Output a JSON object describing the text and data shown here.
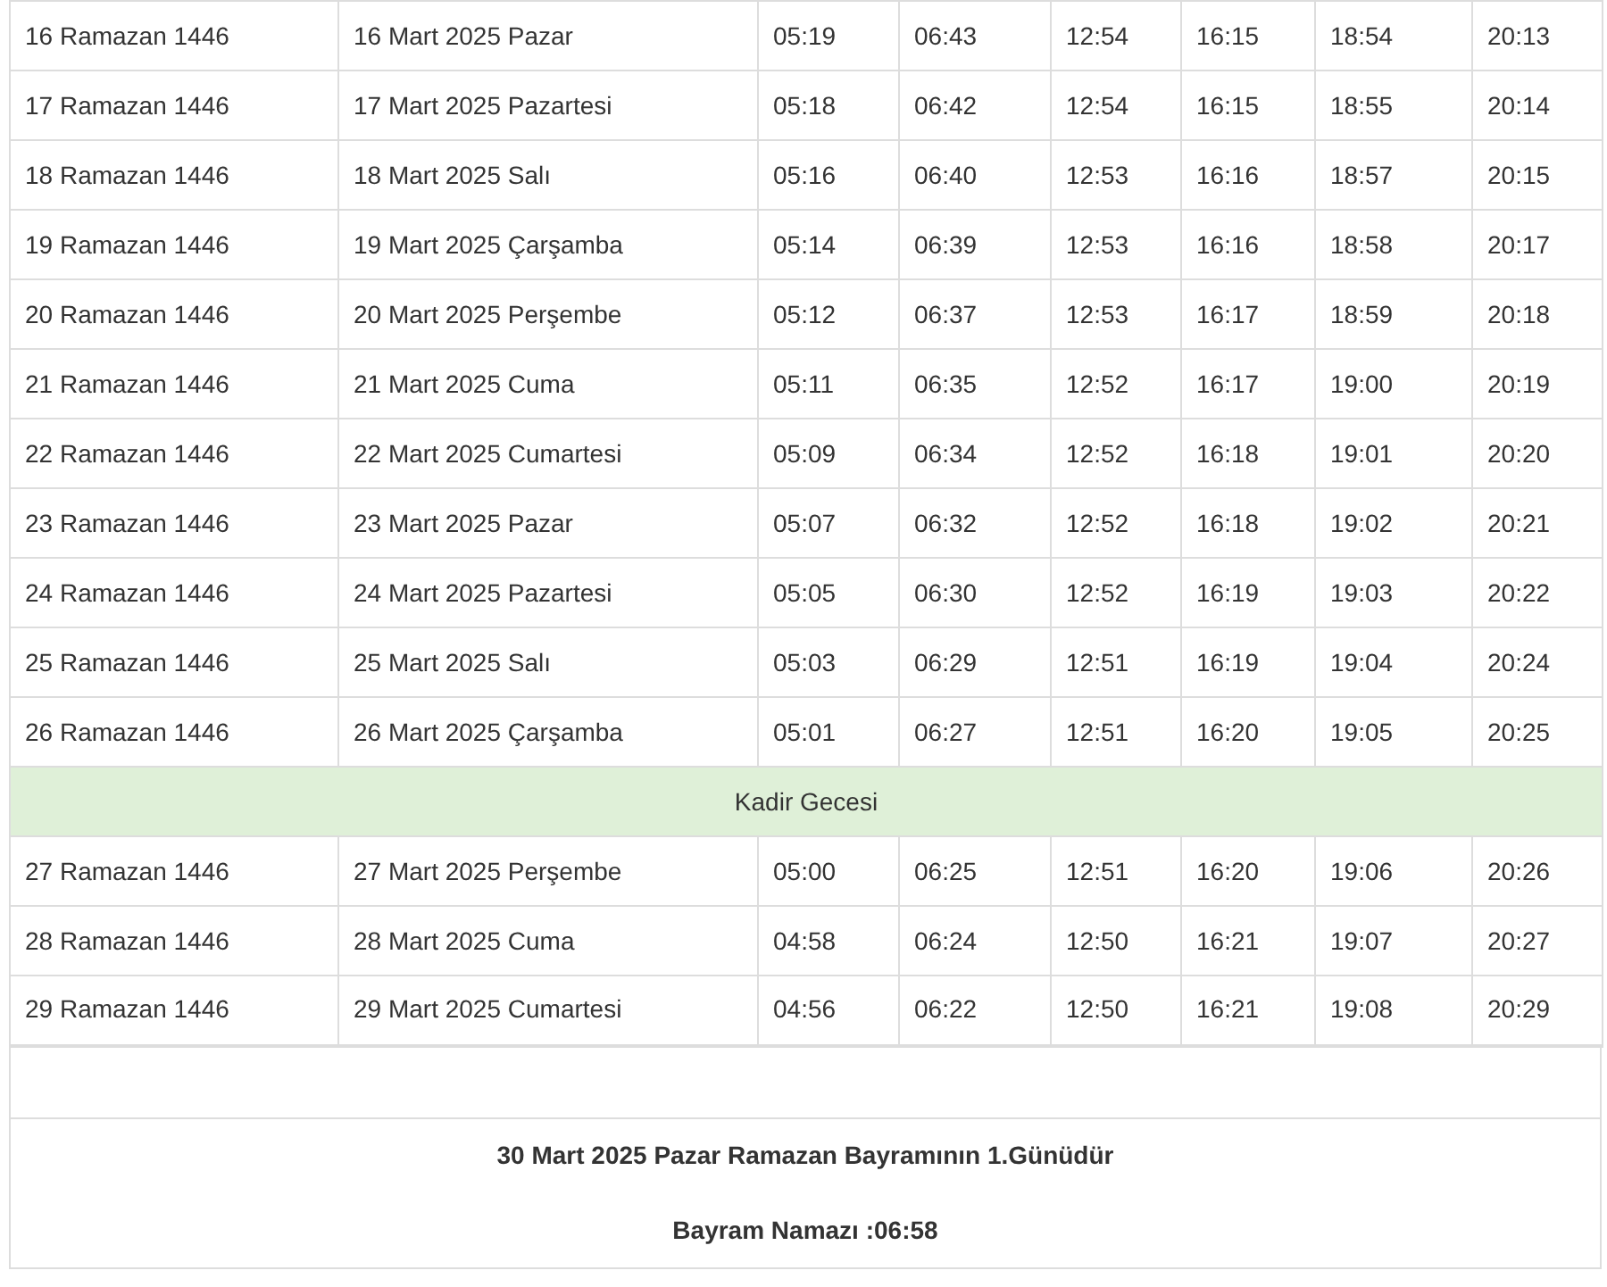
{
  "rows": [
    {
      "kind": "day",
      "cells": [
        "16 Ramazan 1446",
        "16 Mart 2025 Pazar",
        "05:19",
        "06:43",
        "12:54",
        "16:15",
        "18:54",
        "20:13"
      ]
    },
    {
      "kind": "day",
      "cells": [
        "17 Ramazan 1446",
        "17 Mart 2025 Pazartesi",
        "05:18",
        "06:42",
        "12:54",
        "16:15",
        "18:55",
        "20:14"
      ]
    },
    {
      "kind": "day",
      "cells": [
        "18 Ramazan 1446",
        "18 Mart 2025 Salı",
        "05:16",
        "06:40",
        "12:53",
        "16:16",
        "18:57",
        "20:15"
      ]
    },
    {
      "kind": "day",
      "cells": [
        "19 Ramazan 1446",
        "19 Mart 2025 Çarşamba",
        "05:14",
        "06:39",
        "12:53",
        "16:16",
        "18:58",
        "20:17"
      ]
    },
    {
      "kind": "day",
      "cells": [
        "20 Ramazan 1446",
        "20 Mart 2025 Perşembe",
        "05:12",
        "06:37",
        "12:53",
        "16:17",
        "18:59",
        "20:18"
      ]
    },
    {
      "kind": "day",
      "cells": [
        "21 Ramazan 1446",
        "21 Mart 2025 Cuma",
        "05:11",
        "06:35",
        "12:52",
        "16:17",
        "19:00",
        "20:19"
      ]
    },
    {
      "kind": "day",
      "cells": [
        "22 Ramazan 1446",
        "22 Mart 2025 Cumartesi",
        "05:09",
        "06:34",
        "12:52",
        "16:18",
        "19:01",
        "20:20"
      ]
    },
    {
      "kind": "day",
      "cells": [
        "23 Ramazan 1446",
        "23 Mart 2025 Pazar",
        "05:07",
        "06:32",
        "12:52",
        "16:18",
        "19:02",
        "20:21"
      ]
    },
    {
      "kind": "day",
      "cells": [
        "24 Ramazan 1446",
        "24 Mart 2025 Pazartesi",
        "05:05",
        "06:30",
        "12:52",
        "16:19",
        "19:03",
        "20:22"
      ]
    },
    {
      "kind": "day",
      "cells": [
        "25 Ramazan 1446",
        "25 Mart 2025 Salı",
        "05:03",
        "06:29",
        "12:51",
        "16:19",
        "19:04",
        "20:24"
      ]
    },
    {
      "kind": "day",
      "cells": [
        "26 Ramazan 1446",
        "26 Mart 2025 Çarşamba",
        "05:01",
        "06:27",
        "12:51",
        "16:20",
        "19:05",
        "20:25"
      ]
    },
    {
      "kind": "note",
      "text": "Kadir Gecesi"
    },
    {
      "kind": "day",
      "cells": [
        "27 Ramazan 1446",
        "27 Mart 2025 Perşembe",
        "05:00",
        "06:25",
        "12:51",
        "16:20",
        "19:06",
        "20:26"
      ]
    },
    {
      "kind": "day",
      "cells": [
        "28 Ramazan 1446",
        "28 Mart 2025 Cuma",
        "04:58",
        "06:24",
        "12:50",
        "16:21",
        "19:07",
        "20:27"
      ]
    },
    {
      "kind": "day",
      "cells": [
        "29 Ramazan 1446",
        "29 Mart 2025 Cumartesi",
        "04:56",
        "06:22",
        "12:50",
        "16:21",
        "19:08",
        "20:29"
      ]
    }
  ],
  "footer": {
    "lines": [
      "30 Mart 2025 Pazar Ramazan Bayramının 1.Günüdür",
      "Bayram Namazı :06:58"
    ]
  }
}
